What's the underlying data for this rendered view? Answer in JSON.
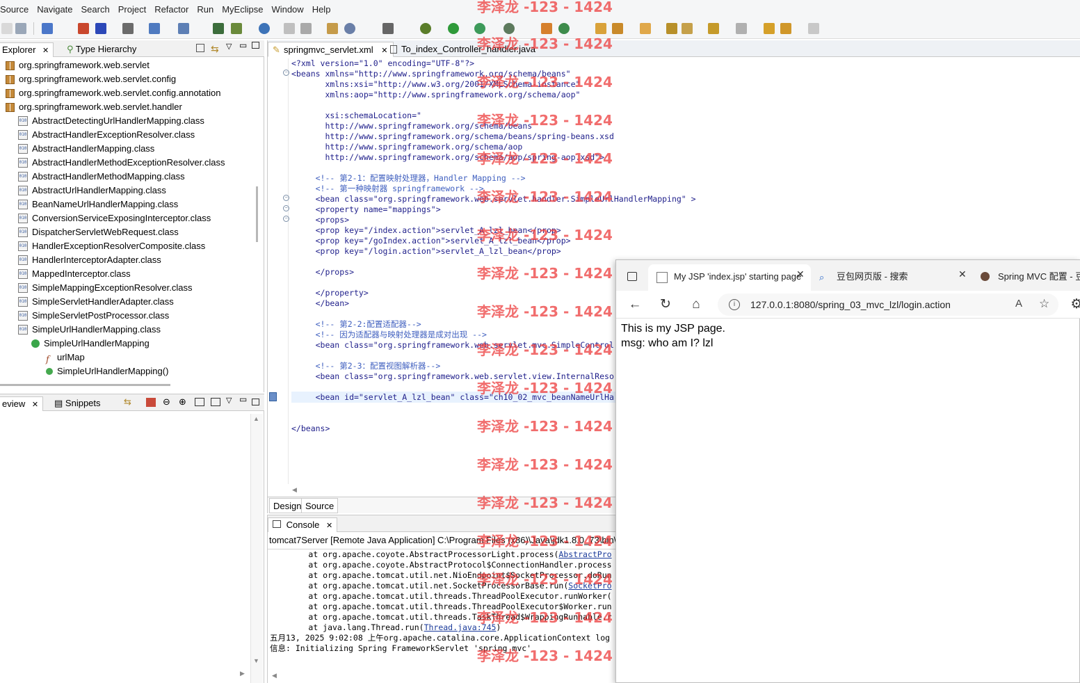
{
  "menu": [
    "Source",
    "Navigate",
    "Search",
    "Project",
    "Refactor",
    "Run",
    "MyEclipse",
    "Window",
    "Help"
  ],
  "explorer": {
    "tab_label": "Explorer",
    "tab2_label": "Type Hierarchy",
    "items": [
      {
        "label": "org.springframework.web.servlet",
        "kind": "package"
      },
      {
        "label": "org.springframework.web.servlet.config",
        "kind": "package"
      },
      {
        "label": "org.springframework.web.servlet.config.annotation",
        "kind": "package"
      },
      {
        "label": "org.springframework.web.servlet.handler",
        "kind": "package"
      },
      {
        "label": "AbstractDetectingUrlHandlerMapping.class",
        "kind": "classfile"
      },
      {
        "label": "AbstractHandlerExceptionResolver.class",
        "kind": "classfile"
      },
      {
        "label": "AbstractHandlerMapping.class",
        "kind": "classfile"
      },
      {
        "label": "AbstractHandlerMethodExceptionResolver.class",
        "kind": "classfile"
      },
      {
        "label": "AbstractHandlerMethodMapping.class",
        "kind": "classfile"
      },
      {
        "label": "AbstractUrlHandlerMapping.class",
        "kind": "classfile"
      },
      {
        "label": "BeanNameUrlHandlerMapping.class",
        "kind": "classfile"
      },
      {
        "label": "ConversionServiceExposingInterceptor.class",
        "kind": "classfile"
      },
      {
        "label": "DispatcherServletWebRequest.class",
        "kind": "classfile"
      },
      {
        "label": "HandlerExceptionResolverComposite.class",
        "kind": "classfile"
      },
      {
        "label": "HandlerInterceptorAdapter.class",
        "kind": "classfile"
      },
      {
        "label": "MappedInterceptor.class",
        "kind": "classfile"
      },
      {
        "label": "SimpleMappingExceptionResolver.class",
        "kind": "classfile"
      },
      {
        "label": "SimpleServletHandlerAdapter.class",
        "kind": "classfile"
      },
      {
        "label": "SimpleServletPostProcessor.class",
        "kind": "classfile"
      },
      {
        "label": "SimpleUrlHandlerMapping.class",
        "kind": "classfile"
      },
      {
        "label": "SimpleUrlHandlerMapping",
        "kind": "class"
      },
      {
        "label": "urlMap",
        "kind": "field"
      },
      {
        "label": "SimpleUrlHandlerMapping()",
        "kind": "method"
      }
    ]
  },
  "preview": {
    "tab_label": "eview",
    "tab2_label": "Snippets"
  },
  "editor": {
    "tabs": [
      {
        "label": "springmvc_servlet.xml",
        "active": true
      },
      {
        "label": "To_index_Controller_handler.java",
        "active": false
      }
    ],
    "lines": [
      "<?xml version=\"1.0\" encoding=\"UTF-8\"?>",
      "<beans xmlns=\"http://www.springframework.org/schema/beans\"",
      "       xmlns:xsi=\"http://www.w3.org/2001/XMLSchema-instance\"",
      "       xmlns:aop=\"http://www.springframework.org/schema/aop\"",
      "",
      "       xsi:schemaLocation=\"",
      "       http://www.springframework.org/schema/beans",
      "       http://www.springframework.org/schema/beans/spring-beans.xsd",
      "       http://www.springframework.org/schema/aop",
      "       http://www.springframework.org/schema/aop/spring-aop.xsd\">",
      "",
      "     <!-- 第2-1：配置映射处理器，Handler Mapping -->",
      "     <!-- 第一种映射器 springframework -->",
      "     <bean class=\"org.springframework.web.servlet.handler.SimpleUrlHandlerMapping\" >",
      "     <property name=\"mappings\">",
      "     <props>",
      "     <prop key=\"/index.action\">servlet_A_lzl_bean</prop>",
      "     <prop key=\"/goIndex.action\">servlet_A_lzl_bean</prop>",
      "     <prop key=\"/login.action\">servlet_A_lzl_bean</prop>",
      "",
      "     </props>",
      "",
      "     </property>",
      "     </bean>",
      "",
      "     <!-- 第2-2:配置适配器-->",
      "     <!-- 因为适配器与映射处理器是成对出现 -->",
      "     <bean class=\"org.springframework.web.servlet.mvc.SimpleControl",
      "",
      "     <!-- 第2-3：配置视图解析器-->",
      "     <bean class=\"org.springframework.web.servlet.view.InternalReso",
      "",
      "     <bean id=\"servlet_A_lzl_bean\" class=\"ch10_02_mvc_beanNameUrlHa",
      "",
      "",
      "</beans>"
    ],
    "design_tab": "Design",
    "source_tab": "Source"
  },
  "console": {
    "tab_label": "Console",
    "path": "tomcat7Server [Remote Java Application] C:\\Program Files (x86)\\Java\\jdk1.8.0_73\\bin\\",
    "lines": [
      {
        "text": "\tat org.apache.coyote.AbstractProcessorLight.process(",
        "link": "AbstractPro"
      },
      {
        "text": "\tat org.apache.coyote.AbstractProtocol$ConnectionHandler.process",
        "link": ""
      },
      {
        "text": "\tat org.apache.tomcat.util.net.NioEndpoint$SocketProcessor.doRun",
        "link": ""
      },
      {
        "text": "\tat org.apache.tomcat.util.net.SocketProcessorBase.run(",
        "link": "SocketPro"
      },
      {
        "text": "\tat org.apache.tomcat.util.threads.ThreadPoolExecutor.runWorker(",
        "link": ""
      },
      {
        "text": "\tat org.apache.tomcat.util.threads.ThreadPoolExecutor$Worker.run",
        "link": ""
      },
      {
        "text": "\tat org.apache.tomcat.util.threads.TaskThread$WrappingRunnable.r",
        "link": ""
      },
      {
        "text": "\tat java.lang.Thread.run(",
        "link": "Thread.java:745",
        "suffix": ")"
      },
      {
        "text": "五月13, 2025 9:02:08 上午org.apache.catalina.core.ApplicationContext log",
        "link": ""
      },
      {
        "text": "信息: Initializing Spring FrameworkServlet 'spring_mvc'",
        "link": ""
      }
    ]
  },
  "browser": {
    "tabs": [
      {
        "label": "My JSP 'index.jsp' starting page",
        "active": true
      },
      {
        "label": "豆包网页版 - 搜索",
        "active": false
      },
      {
        "label": "Spring MVC 配置 - 豆包",
        "active": false
      }
    ],
    "url": "127.0.0.1:8080/spring_03_mvc_lzl/login.action",
    "page_line1": "This is my JSP page.",
    "page_line2": "msg: who am I? lzl"
  },
  "watermark": "李泽龙 -123 - 1424",
  "icons": [
    "package-icon",
    "classfile-icon",
    "class-icon",
    "field-icon",
    "method-icon",
    "close-icon",
    "back-icon",
    "refresh-icon",
    "home-icon",
    "info-icon",
    "favorite-icon",
    "search-icon"
  ]
}
